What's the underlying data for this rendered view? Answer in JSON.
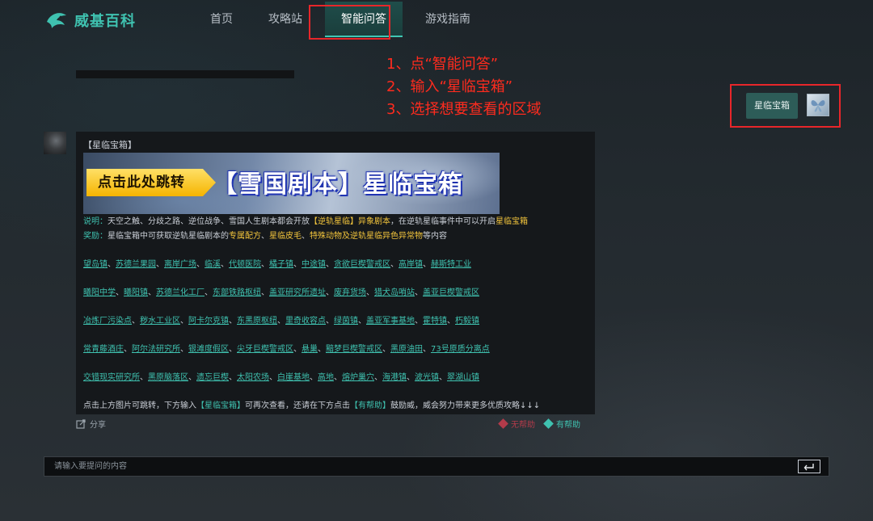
{
  "brand": {
    "logo_text": "威基百科"
  },
  "nav": {
    "items": [
      {
        "label": "首页"
      },
      {
        "label": "攻略站"
      },
      {
        "label": "智能问答"
      },
      {
        "label": "游戏指南"
      }
    ],
    "active_index": 2
  },
  "instructions": [
    "1、点“智能问答”",
    "2、输入“星临宝箱”",
    "3、选择想要查看的区域"
  ],
  "user_query": {
    "text": "星临宝箱"
  },
  "answer": {
    "tag": "【星临宝箱】",
    "banner": {
      "cta": "点击此处跳转",
      "title": "【雪国剧本】星临宝箱"
    },
    "desc": {
      "label": "说明：",
      "text_1": "天空之触、分歧之路、逆位战争、雪国人生剧本都会开放",
      "hl_1": "【逆轨星临】异象剧本",
      "text_2": "，在逆轨星临事件中可以开启",
      "hl_2": "星临宝箱"
    },
    "reward": {
      "label": "奖励：",
      "text_1": "星临宝箱中可获取逆轨星临剧本的",
      "hl_1": "专属配方",
      "sep_1": "、",
      "hl_2": "星临皮毛",
      "sep_2": "、",
      "hl_3": "特殊动物及逆轨星临异色异常物",
      "text_2": "等内容"
    },
    "location_rows": [
      [
        "望岛镇",
        "苏德兰果园",
        "离岸广场",
        "临溪",
        "代顿医院",
        "橘子镇",
        "中途镇",
        "贪欲巨楔警戒区",
        "高岸镇",
        "赫斯特工业"
      ],
      [
        "曦阳中学",
        "曦阳镇",
        "苏德兰化工厂",
        "东部铁路枢纽",
        "盖亚研究所遗址",
        "废弃货场",
        "猎犬岛哨站",
        "盖亚巨楔警戒区"
      ],
      [
        "冶炼厂污染点",
        "秽水工业区",
        "阿卡尔克镇",
        "东黑原枢纽",
        "里奇收容点",
        "绿茵镇",
        "盖亚军事基地",
        "霍特镇",
        "朽毅镇"
      ],
      [
        "常青藤酒庄",
        "阿尔法研究所",
        "银滩度假区",
        "尖牙巨楔警戒区",
        "悬巢",
        "黯梦巨楔警戒区",
        "黑原油田",
        "73号原质分离点"
      ],
      [
        "交错现实研究所",
        "黑原脑落区",
        "遗忘巨楔",
        "太阳农场",
        "白崖基地",
        "高地",
        "熔炉巢穴",
        "海港镇",
        "波光镇",
        "翠湖山镇"
      ]
    ],
    "location_separator": "、",
    "footer": {
      "text_1": "点击上方图片可跳转，下方输入",
      "green_1": "【星临宝箱】",
      "text_2": "可再次查看，还请在下方点击",
      "green_2": "【有帮助】",
      "text_3": "鼓励威，威会努力带来更多优质攻略↓↓↓"
    }
  },
  "actions": {
    "share": "分享",
    "not_helpful": "无帮助",
    "helpful": "有帮助"
  },
  "input": {
    "placeholder": "请输入要提问的内容"
  },
  "colors": {
    "accent": "#3fc2b0",
    "highlight": "#f3c53c",
    "annotation_red": "#e8262a",
    "not_helpful": "#b23b4a"
  },
  "icons": {
    "logo": "ghost-shark-logo-icon",
    "share": "share-icon",
    "enter": "enter-key-icon"
  }
}
